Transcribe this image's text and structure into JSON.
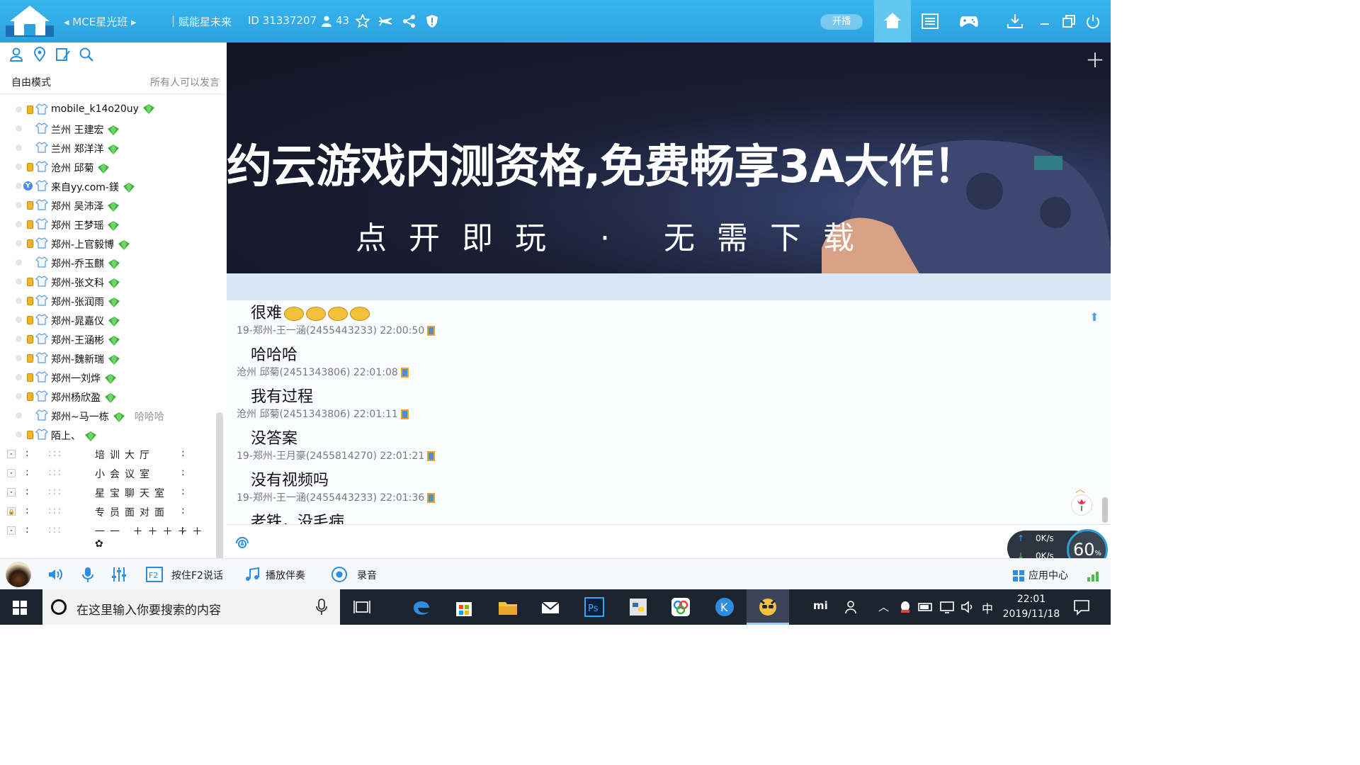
{
  "titlebar": {
    "channel_name": "◂ MCE星光班 ▸",
    "slogan": "赋能星未来",
    "channel_id": "ID 31337207",
    "online_count": "43",
    "broadcast_label": "开播"
  },
  "leftpanel": {
    "mode_label": "自由模式",
    "speak_rule": "所有人可以发言",
    "users": [
      {
        "name": "mobile_k14o20uy",
        "badge": true,
        "vip": false,
        "note": ""
      },
      {
        "name": "兰州  王建宏",
        "badge": false,
        "vip": false,
        "note": ""
      },
      {
        "name": "兰州 郑洋洋",
        "badge": false,
        "vip": false,
        "note": ""
      },
      {
        "name": "沧州 邱菊",
        "badge": true,
        "vip": false,
        "note": ""
      },
      {
        "name": "来自yy.com-鎂",
        "badge": false,
        "vip": true,
        "note": ""
      },
      {
        "name": "郑州 吴沛泽",
        "badge": true,
        "vip": false,
        "note": ""
      },
      {
        "name": "郑州 王梦瑶",
        "badge": true,
        "vip": false,
        "note": ""
      },
      {
        "name": "郑州-上官毅博",
        "badge": true,
        "vip": false,
        "note": ""
      },
      {
        "name": "郑州-乔玉麒",
        "badge": false,
        "vip": false,
        "note": ""
      },
      {
        "name": "郑州-张文科",
        "badge": true,
        "vip": false,
        "note": ""
      },
      {
        "name": "郑州-张润雨",
        "badge": true,
        "vip": false,
        "note": ""
      },
      {
        "name": "郑州-晁嘉仪",
        "badge": true,
        "vip": false,
        "note": ""
      },
      {
        "name": "郑州-王涵彬",
        "badge": true,
        "vip": false,
        "note": ""
      },
      {
        "name": "郑州-魏新瑞",
        "badge": true,
        "vip": false,
        "note": ""
      },
      {
        "name": "郑州一刘烨",
        "badge": true,
        "vip": false,
        "note": ""
      },
      {
        "name": "郑州杨欣盈",
        "badge": true,
        "vip": false,
        "note": ""
      },
      {
        "name": "郑州~马一栋",
        "badge": false,
        "vip": false,
        "note": "哈哈哈"
      },
      {
        "name": "陌上、",
        "badge": true,
        "vip": false,
        "note": ""
      }
    ],
    "rooms": [
      {
        "name": "培训大厅",
        "locked": false
      },
      {
        "name": "小会议室",
        "locked": false
      },
      {
        "name": "星宝聊天室",
        "locked": false
      },
      {
        "name": "专员面对面",
        "locked": true
      },
      {
        "name": "一一 ＋＋＋＋＋✿",
        "locked": false
      }
    ]
  },
  "banner": {
    "headline": "约云游戏内测资格,免费畅享3A大作！",
    "subline": "点开即玩 · 无需下载"
  },
  "chat": {
    "messages": [
      {
        "text": "很难",
        "meta": "",
        "emojis": 4
      },
      {
        "text": "",
        "meta": "19-郑州-王一涵(2455443233) 22:00:50"
      },
      {
        "text": "哈哈哈",
        "meta": ""
      },
      {
        "text": "",
        "meta": "沧州 邱菊(2451343806) 22:01:08"
      },
      {
        "text": "我有过程",
        "meta": ""
      },
      {
        "text": "",
        "meta": "沧州 邱菊(2451343806) 22:01:11"
      },
      {
        "text": "没答案",
        "meta": ""
      },
      {
        "text": "",
        "meta": "19-郑州-王月豪(2455814270) 22:01:21"
      },
      {
        "text": "没有视频吗",
        "meta": ""
      },
      {
        "text": "",
        "meta": "19-郑州-王一涵(2455443233) 22:01:36"
      },
      {
        "text": "老铁，没毛病",
        "meta": ""
      }
    ]
  },
  "network": {
    "up": "0K/s",
    "down": "0K/s",
    "percent": "60",
    "percent_unit": "%"
  },
  "bottombar": {
    "f2_label": "按住F2说话",
    "music_label": "播放伴奏",
    "record_label": "录音",
    "app_center": "应用中心"
  },
  "taskbar": {
    "search_placeholder": "在这里输入你要搜索的内容",
    "ime": "中",
    "time": "22:01",
    "date": "2019/11/18"
  },
  "colors": {
    "titlebar": "#2aa2e0",
    "accent": "#4a8fd9",
    "gem": "#3fae3a",
    "taskbar": "#1c2430"
  }
}
